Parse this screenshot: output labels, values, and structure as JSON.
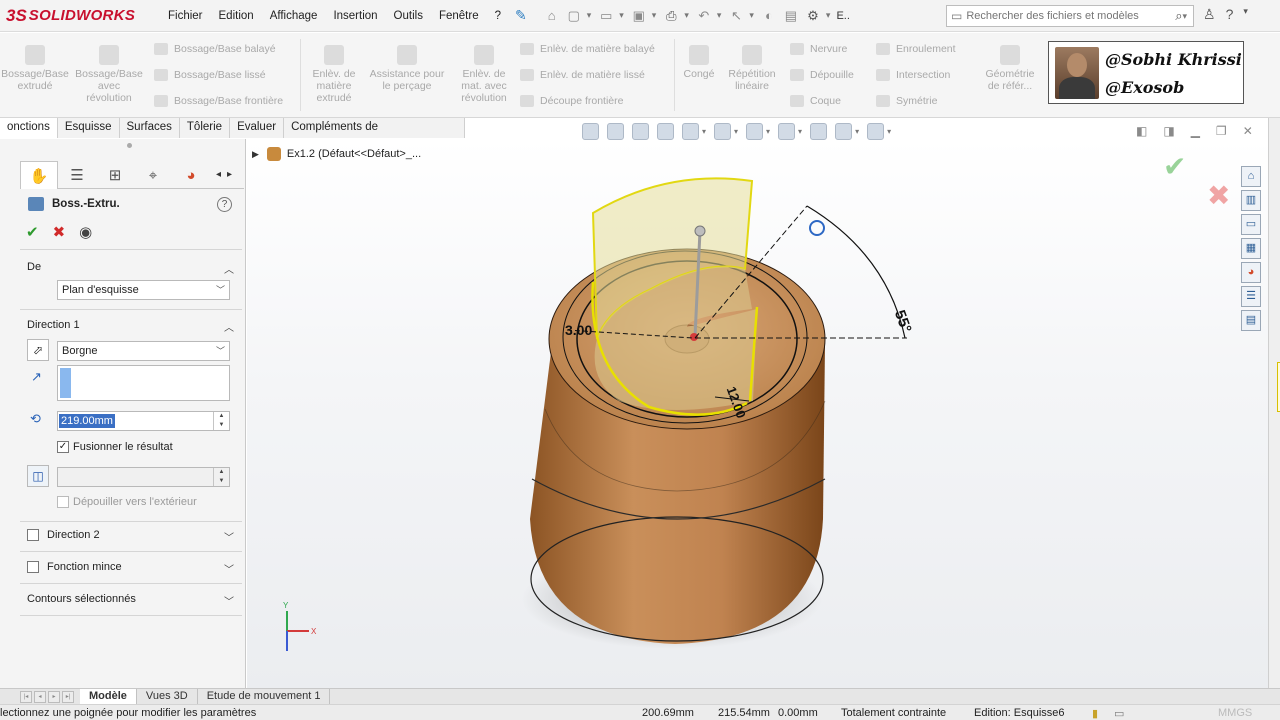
{
  "app": {
    "logo_prefix": "3S",
    "logo_text": "SOLIDWORKS",
    "menu": [
      "Fichier",
      "Edition",
      "Affichage",
      "Insertion",
      "Outils",
      "Fenêtre",
      "?"
    ],
    "truncated_menu": "E..",
    "search_placeholder": "Rechercher des fichiers et modèles"
  },
  "command_manager": {
    "extrude_boss": "Bossage/Base\nextrudé",
    "revolve_boss": "Bossage/Base\navec\nrévolution",
    "swept_boss": "Bossage/Base balayé",
    "lofted_boss": "Bossage/Base lissé",
    "boundary_boss": "Bossage/Base frontière",
    "extrude_cut": "Enlèv. de\nmatière\nextrudé",
    "hole_wizard": "Assistance pour\nle perçage",
    "revolve_cut": "Enlèv. de\nmat. avec\nrévolution",
    "swept_cut": "Enlèv. de matière balayé",
    "lofted_cut": "Enlèv. de matière lissé",
    "boundary_cut": "Découpe frontière",
    "fillet": "Congé",
    "linear_pattern": "Répétition\nlinéaire",
    "rib": "Nervure",
    "draft": "Dépouille",
    "shell": "Coque",
    "wrap": "Enroulement",
    "intersect": "Intersection",
    "mirror": "Symétrie",
    "ref_geometry": "Géométrie\nde référ..."
  },
  "author": {
    "line1": "@Sobhi Khrissi",
    "line2": "@Exosob"
  },
  "tabs": [
    "onctions",
    "Esquisse",
    "Surfaces",
    "Tôlerie",
    "Evaluer",
    "Compléments de SOLIDWORKS"
  ],
  "property_manager": {
    "title": "Boss.-Extru.",
    "help": "?",
    "from": {
      "header": "De",
      "value": "Plan d'esquisse"
    },
    "direction1": {
      "header": "Direction 1",
      "end_condition": "Borgne",
      "depth": "219.00mm",
      "merge_result": "Fusionner le résultat",
      "merge_checked": true,
      "draft_outward": "Dépouiller vers l'extérieur"
    },
    "direction2": "Direction 2",
    "thin_feature": "Fonction mince",
    "selected_contours": "Contours sélectionnés"
  },
  "viewport": {
    "breadcrumb": "Ex1.2  (Défaut<<Défaut>_...",
    "dim_radius": "3.00",
    "dim_width": "12.00",
    "dim_angle": "55°",
    "triad_x": "X",
    "triad_y": "Y"
  },
  "bottom_tabs": [
    "Modèle",
    "Vues 3D",
    "Etude de mouvement 1"
  ],
  "status": {
    "message": "lectionnez une poignée pour modifier les paramètres",
    "x": "200.69mm",
    "y": "215.54mm",
    "z": "0.00mm",
    "state": "Totalement contrainte",
    "editing": "Edition: Esquisse6",
    "units": "MMGS"
  }
}
